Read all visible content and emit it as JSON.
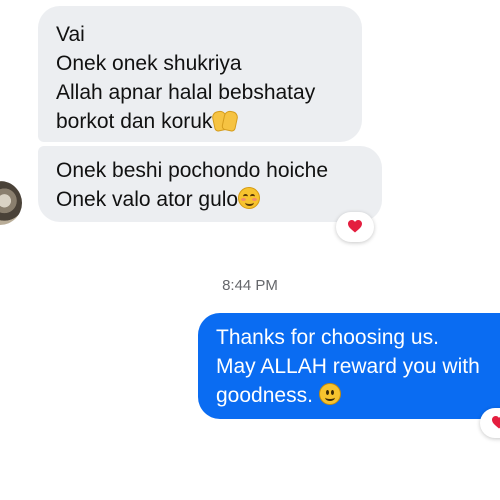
{
  "conversation": {
    "incoming": [
      {
        "lines": [
          "Vai",
          "Onek onek shukriya",
          "Allah apnar halal bebshatay",
          "borkot dan koruk"
        ],
        "emoji": "palms-up-together-icon"
      },
      {
        "lines": [
          "Onek beshi pochondo hoiche",
          "Onek valo ator gulo"
        ],
        "emoji": "smiling-face-with-smiling-eyes-icon",
        "reaction": "red-heart-icon"
      }
    ],
    "timestamp": "8:44 PM",
    "outgoing": {
      "lines": [
        "Thanks for choosing us.",
        "May ALLAH reward you with",
        "goodness."
      ],
      "emoji": "slightly-smiling-face-icon",
      "reaction": "red-heart-icon"
    }
  },
  "colors": {
    "incoming_bubble": "#eceef1",
    "outgoing_bubble": "#0a6cf2",
    "heart": "#e41e3f",
    "timestamp_text": "#65676b"
  }
}
